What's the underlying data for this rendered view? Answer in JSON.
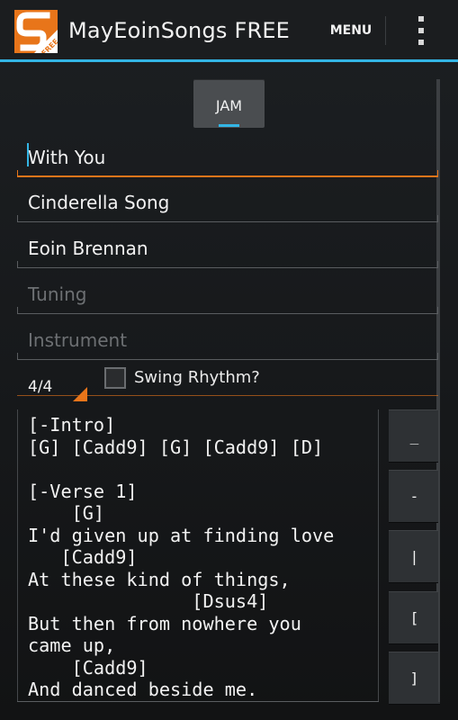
{
  "app": {
    "title": "MayEoinSongs FREE",
    "icon_badge": "FREE",
    "menu_label": "MENU",
    "accent_color": "#33b5e5",
    "focus_color": "#e8751a"
  },
  "jam": {
    "label": "JAM"
  },
  "fields": {
    "title": {
      "value": "With You"
    },
    "album": {
      "value": "Cinderella Song"
    },
    "artist": {
      "value": "Eoin Brennan"
    },
    "tuning": {
      "value": "",
      "placeholder": "Tuning"
    },
    "instrument": {
      "value": "",
      "placeholder": "Instrument"
    }
  },
  "time_signature": {
    "selected": "4/4"
  },
  "swing": {
    "label": "Swing Rhythm?",
    "checked": false
  },
  "chord_text": "[-Intro]\n[G] [Cadd9] [G] [Cadd9] [D]\n\n[-Verse 1]\n    [G]\nI'd given up at finding love\n   [Cadd9]\nAt these kind of things,\n               [Dsus4]\nBut then from nowhere you\ncame up,\n    [Cadd9]\nAnd danced beside me.",
  "side_buttons": [
    {
      "label": "_"
    },
    {
      "label": "-"
    },
    {
      "label": "|"
    },
    {
      "label": "["
    },
    {
      "label": "]"
    }
  ]
}
